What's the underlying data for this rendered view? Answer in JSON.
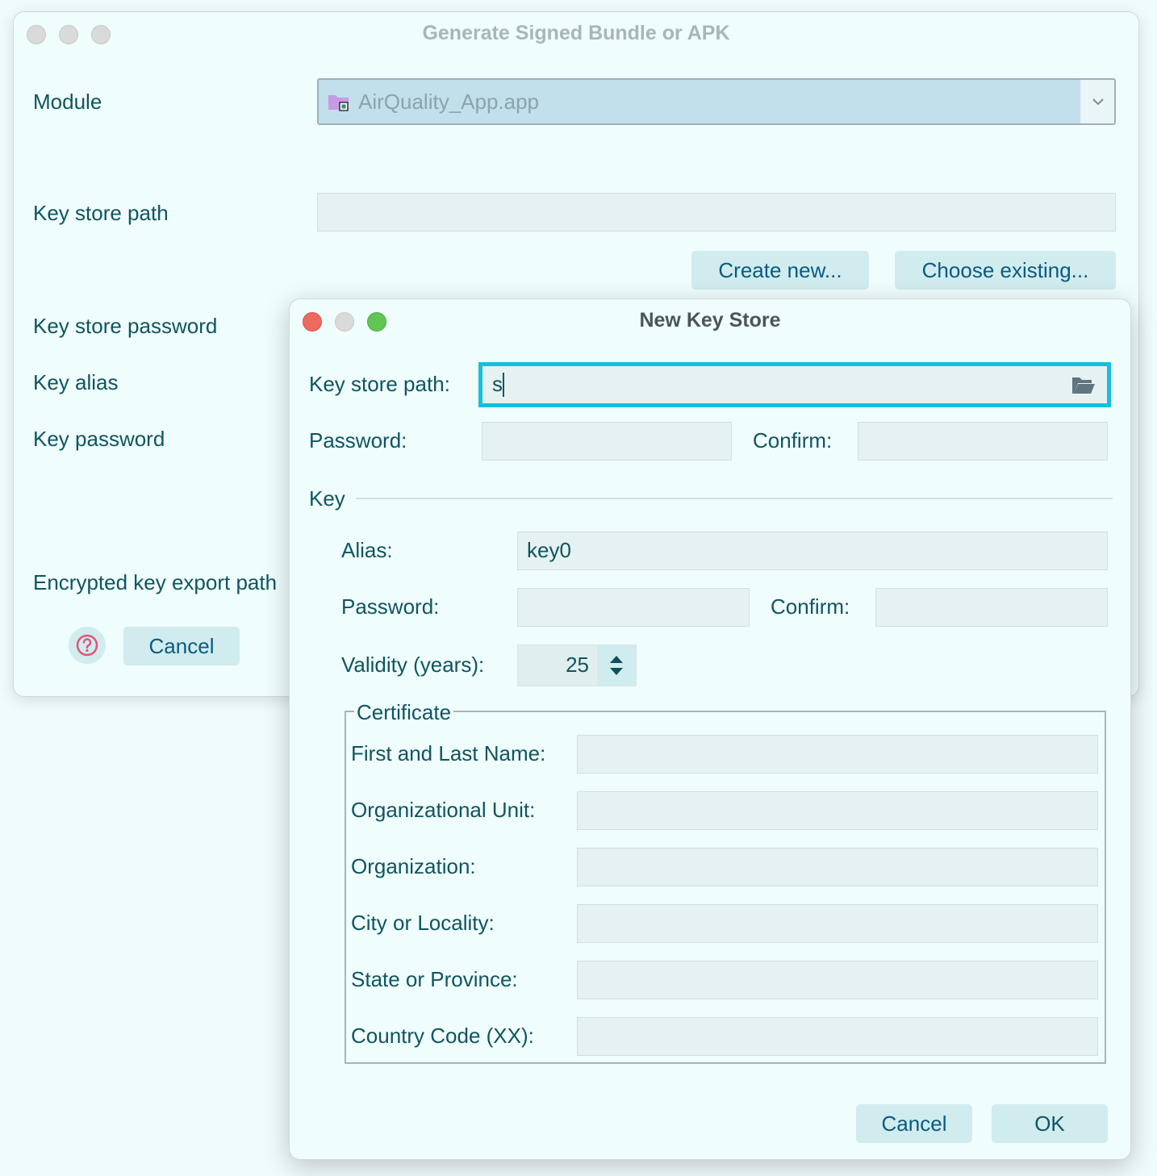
{
  "background_dialog": {
    "title": "Generate Signed Bundle or APK",
    "module_label": "Module",
    "module_value": "AirQuality_App.app",
    "key_store_path_label": "Key store path",
    "key_store_path_value": "",
    "create_new_label": "Create new...",
    "choose_existing_label": "Choose existing...",
    "key_store_password_label": "Key store password",
    "key_alias_label": "Key alias",
    "key_password_label": "Key password",
    "encrypted_key_export_path_label": "Encrypted key export path",
    "cancel_label": "Cancel"
  },
  "new_key_store_dialog": {
    "title": "New Key Store",
    "key_store_path_label": "Key store path:",
    "key_store_path_value": "s",
    "password_label": "Password:",
    "confirm_label": "Confirm:",
    "key_section_label": "Key",
    "alias_label": "Alias:",
    "alias_value": "key0",
    "key_password_label": "Password:",
    "key_confirm_label": "Confirm:",
    "validity_label": "Validity (years):",
    "validity_value": "25",
    "certificate_label": "Certificate",
    "first_last_name_label": "First and Last Name:",
    "org_unit_label": "Organizational Unit:",
    "organization_label": "Organization:",
    "city_label": "City or Locality:",
    "state_label": "State or Province:",
    "country_code_label": "Country Code (XX):",
    "cancel_label": "Cancel",
    "ok_label": "OK"
  },
  "colors": {
    "accent_focus": "#15c0dc",
    "text": "#0e5560",
    "button_bg": "#d0ecef",
    "close_red": "#ee6a5f",
    "zoom_green": "#61c554"
  }
}
